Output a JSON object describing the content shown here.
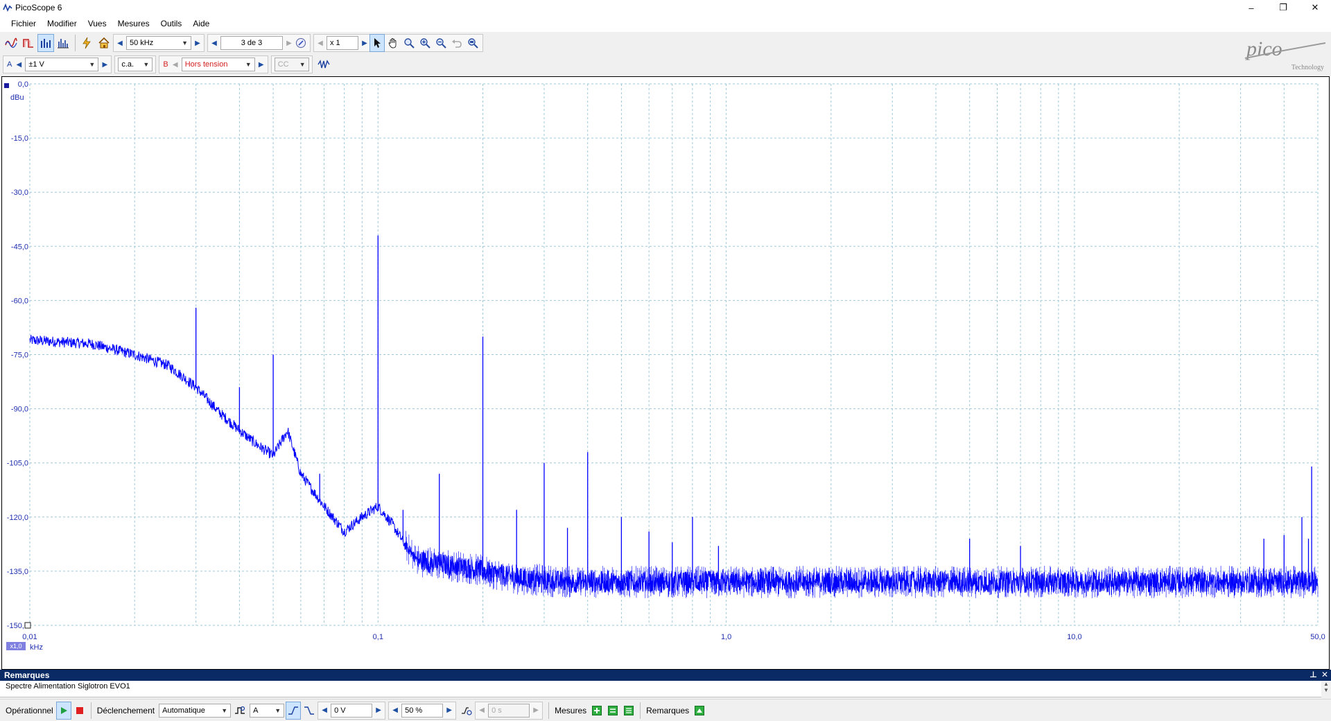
{
  "window": {
    "title": "PicoScope 6",
    "minimize": "–",
    "restore": "❐",
    "close": "✕"
  },
  "menu": [
    "Fichier",
    "Modifier",
    "Vues",
    "Mesures",
    "Outils",
    "Aide"
  ],
  "toolbar1": {
    "icons": [
      "scope-mode-icon",
      "persistence-mode-icon",
      "spectrum-mode-icon",
      "spectrum-options-icon",
      "signal-generator-icon",
      "home-icon"
    ],
    "range_value": "50 kHz",
    "buffer_value": "3 de 3",
    "zoom_value": "x 1"
  },
  "toolbar2": {
    "channel_a": {
      "label": "A",
      "range": "±1 V",
      "coupling": "c.a."
    },
    "channel_b": {
      "label": "B",
      "range": "Hors tension",
      "coupling": "CC"
    }
  },
  "logo": {
    "text": "pico",
    "sub": "Technology"
  },
  "colors": {
    "trace": "#0000ff",
    "axis_text": "#1f2fb0",
    "grid": "#9ec9d9",
    "channel_b": "#d42020",
    "header": "#0a2a66"
  },
  "chart_data": {
    "type": "line",
    "x_scale": "log",
    "xlabel": "kHz",
    "ylabel": "dBu",
    "xlim": [
      0.01,
      50.0
    ],
    "ylim": [
      -150,
      0
    ],
    "y_ticks": [
      "0,0",
      "-15,0",
      "-30,0",
      "-45,0",
      "-60,0",
      "-75,0",
      "-90,0",
      "-105,0",
      "-120,0",
      "-135,0",
      "-150,0"
    ],
    "y_tick_values": [
      0,
      -15,
      -30,
      -45,
      -60,
      -75,
      -90,
      -105,
      -120,
      -135,
      -150
    ],
    "x_ticks": [
      "0,01",
      "0,1",
      "1,0",
      "10,0",
      "50,0"
    ],
    "x_tick_values": [
      0.01,
      0.1,
      1.0,
      10.0,
      50.0
    ],
    "zoom_badge": "x1,0",
    "grid": true,
    "series": [
      {
        "color": "#0000ff",
        "baseline": [
          [
            0.01,
            -71
          ],
          [
            0.015,
            -72
          ],
          [
            0.02,
            -75
          ],
          [
            0.025,
            -78
          ],
          [
            0.03,
            -84
          ],
          [
            0.035,
            -91
          ],
          [
            0.04,
            -96
          ],
          [
            0.045,
            -100
          ],
          [
            0.05,
            -103
          ],
          [
            0.055,
            -96
          ],
          [
            0.06,
            -108
          ],
          [
            0.07,
            -117
          ],
          [
            0.08,
            -124
          ],
          [
            0.09,
            -120
          ],
          [
            0.1,
            -117
          ],
          [
            0.11,
            -122
          ],
          [
            0.12,
            -128
          ],
          [
            0.13,
            -132
          ],
          [
            0.15,
            -133
          ],
          [
            0.18,
            -134
          ],
          [
            0.25,
            -137
          ],
          [
            0.35,
            -138
          ],
          [
            1.0,
            -138
          ],
          [
            10.0,
            -138
          ],
          [
            50.0,
            -138
          ]
        ],
        "peaks": [
          [
            0.03,
            -62
          ],
          [
            0.04,
            -84
          ],
          [
            0.05,
            -75
          ],
          [
            0.068,
            -108
          ],
          [
            0.1,
            -42
          ],
          [
            0.118,
            -118
          ],
          [
            0.15,
            -108
          ],
          [
            0.2,
            -70
          ],
          [
            0.25,
            -118
          ],
          [
            0.3,
            -105
          ],
          [
            0.35,
            -123
          ],
          [
            0.4,
            -102
          ],
          [
            0.5,
            -120
          ],
          [
            0.6,
            -124
          ],
          [
            0.7,
            -127
          ],
          [
            0.8,
            -120
          ],
          [
            0.95,
            -128
          ],
          [
            5.0,
            -126
          ],
          [
            7.0,
            -128
          ],
          [
            35.0,
            -126
          ],
          [
            40.0,
            -125
          ],
          [
            45.0,
            -120
          ],
          [
            47.0,
            -126
          ],
          [
            48.0,
            -106
          ]
        ]
      }
    ]
  },
  "notes": {
    "title": "Remarques",
    "text": "Spectre Alimentation Siglotron EVO1",
    "pin": "⊥",
    "close": "✕"
  },
  "status": {
    "state_label": "Opérationnel",
    "trigger_label": "Déclenchement",
    "trigger_mode": "Automatique",
    "trigger_channel": "A",
    "trigger_level": "0 V",
    "trigger_pos": "50 %",
    "trigger_delay": "0 s",
    "measurements_label": "Mesures",
    "notes_label": "Remarques"
  }
}
